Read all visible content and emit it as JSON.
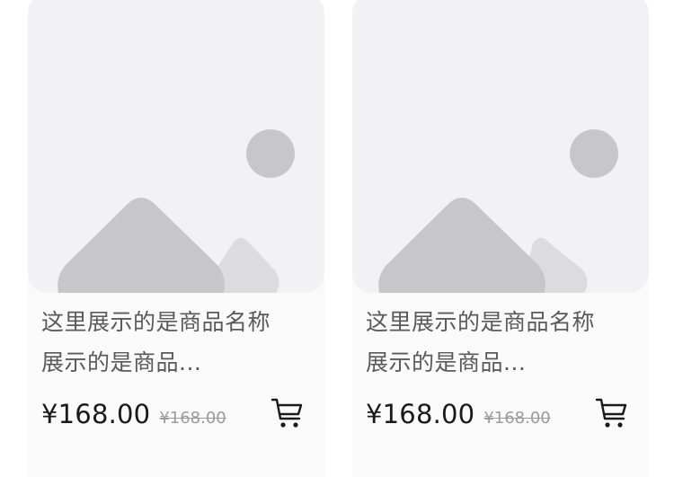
{
  "products": [
    {
      "title_line1": "这里展示的是商品名称",
      "title_line2": "展示的是商品...",
      "price": "¥168.00",
      "old_price": "¥168.00"
    },
    {
      "title_line1": "这里展示的是商品名称",
      "title_line2": "展示的是商品...",
      "price": "¥168.00",
      "old_price": "¥168.00"
    }
  ],
  "colors": {
    "card_bg": "#fafafb",
    "image_bg": "#f2f2f5",
    "placeholder_dark": "#c7c7ca",
    "placeholder_light": "#dcdcde"
  },
  "icons": {
    "image_placeholder": "image-placeholder-icon",
    "cart": "cart-icon"
  }
}
